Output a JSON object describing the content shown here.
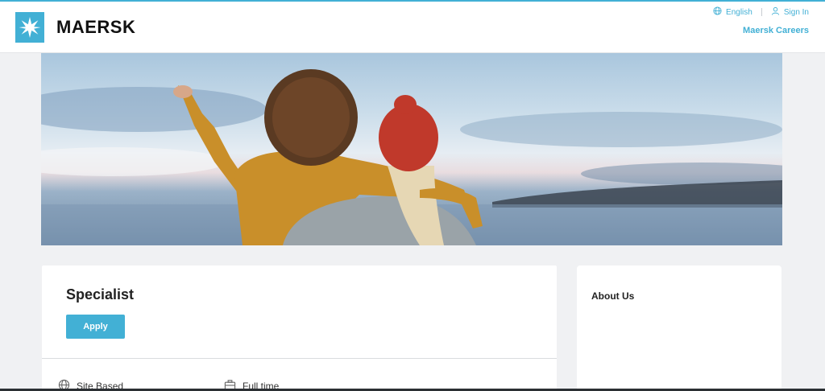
{
  "header": {
    "brand": "MAERSK",
    "language_label": "English",
    "signin_label": "Sign In",
    "careers_label": "Maersk Careers"
  },
  "job": {
    "title": "Specialist",
    "apply_label": "Apply",
    "location_type": "Site Based",
    "employment_type": "Full time"
  },
  "sidebar": {
    "about_title": "About Us"
  },
  "colors": {
    "accent": "#42b0d5",
    "background": "#f0f1f3",
    "card": "#ffffff"
  },
  "icons": [
    "maersk-star-icon",
    "globe-icon",
    "user-icon",
    "globe-icon",
    "briefcase-icon"
  ]
}
